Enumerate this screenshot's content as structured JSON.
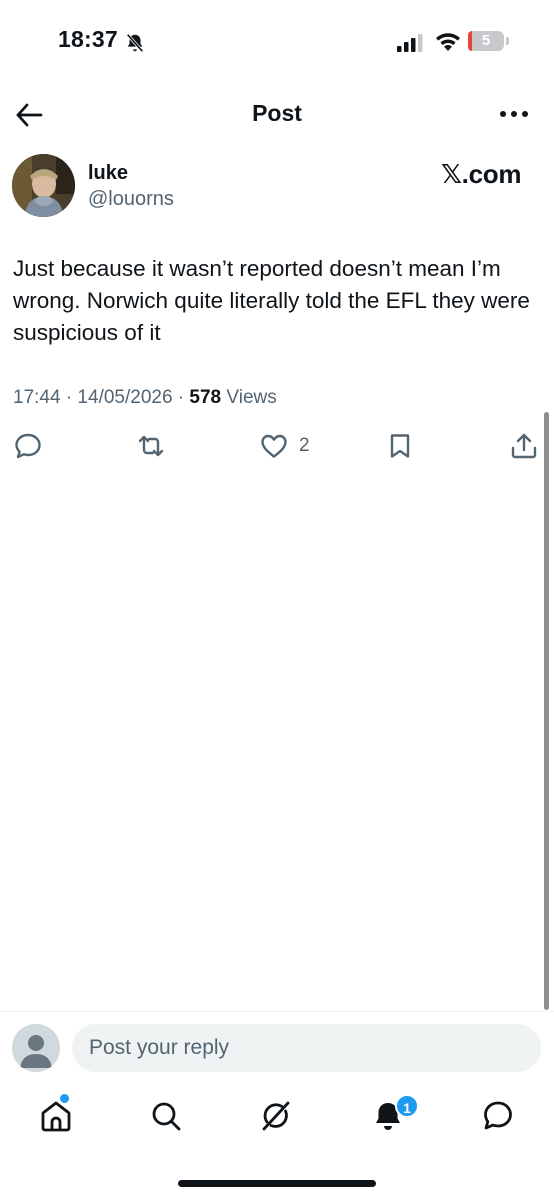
{
  "status_bar": {
    "time": "18:37",
    "battery_level": "5",
    "icons": [
      "bell-slash-icon",
      "cellular-signal-icon",
      "wifi-icon",
      "battery-icon"
    ]
  },
  "header": {
    "title": "Post",
    "back_icon": "arrow-left-icon",
    "more_icon": "more-horizontal-icon"
  },
  "post": {
    "author_name": "luke",
    "author_handle": "@louorns",
    "brand": "𝕏.com",
    "text": "Just because it wasn’t reported doesn’t mean I’m wrong. Norwich quite literally told the EFL they were suspicious of it",
    "timestamp": "17:44 · 14/05/2026 · ",
    "views_count": "578",
    "views_label": " Views",
    "actions": {
      "reply_icon": "reply-bubble-icon",
      "repost_icon": "repost-icon",
      "like_icon": "heart-icon",
      "like_count": "2",
      "bookmark_icon": "bookmark-icon",
      "share_icon": "share-icon"
    }
  },
  "reply": {
    "placeholder": "Post your reply"
  },
  "bottom_nav": {
    "items": [
      "home-icon",
      "search-icon",
      "grok-icon",
      "notifications-icon",
      "messages-icon"
    ],
    "notification_badge": "1"
  },
  "colors": {
    "text_primary": "#0f1419",
    "text_secondary": "#536471",
    "accent": "#1d9bf0",
    "input_bg": "#eff3f4"
  }
}
